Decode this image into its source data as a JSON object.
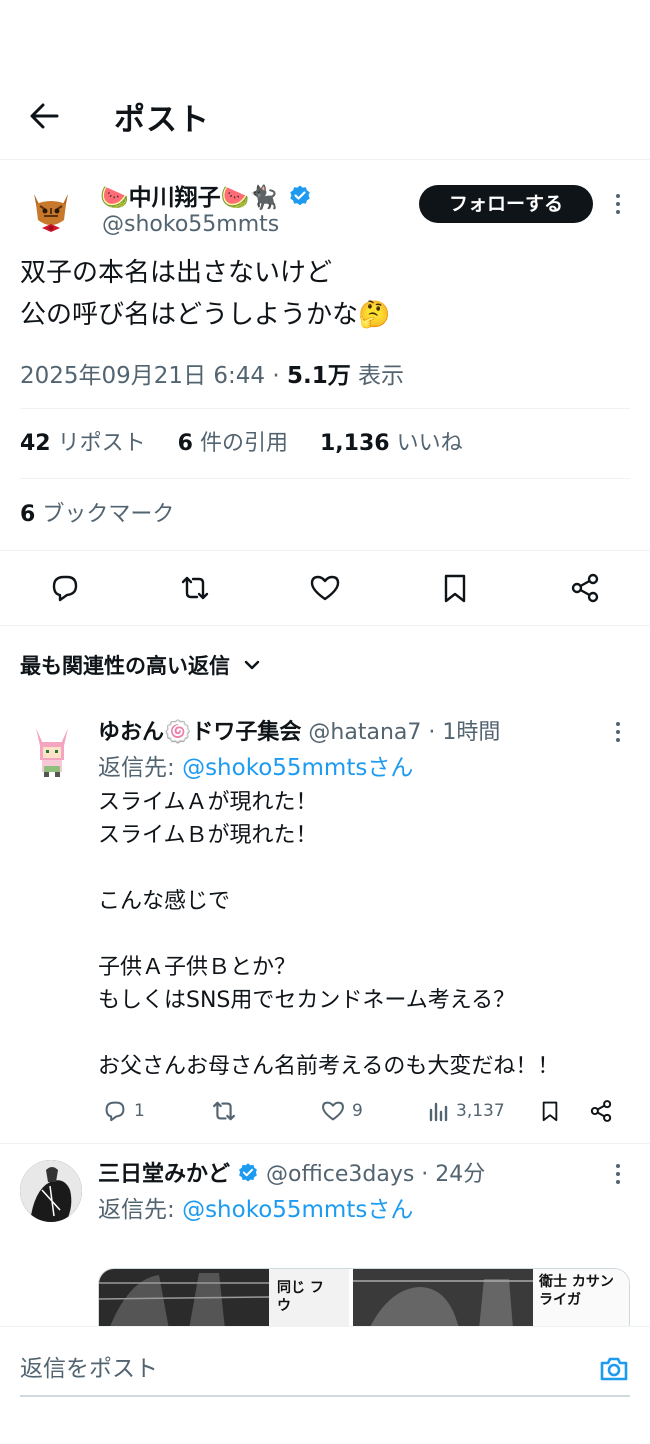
{
  "header": {
    "title": "ポスト"
  },
  "post": {
    "author_name": "🍉中川翔子🍉🐈‍⬛",
    "author_handle": "@shoko55mmts",
    "follow_label": "フォローする",
    "body_line1": "双子の本名は出さないけど",
    "body_line2": "公の呼び名はどうしようかな🤔",
    "timestamp": "2025年09月21日 6:44",
    "views": "5.1万",
    "views_label": "表示",
    "reposts": "42",
    "reposts_label": "リポスト",
    "quotes": "6",
    "quotes_label": "件の引用",
    "likes": "1,136",
    "likes_label": "いいね",
    "bookmarks": "6",
    "bookmarks_label": "ブックマーク"
  },
  "replies_sort": {
    "label": "最も関連性の高い返信"
  },
  "replies": [
    {
      "name": "ゆおん🍥ドワ子集会",
      "handle": "@hatana7",
      "time": "1時間",
      "reply_to_prefix": "返信先:",
      "reply_to_handle": "@shoko55mmtsさん",
      "text": "スライムＡが現れた！\nスライムＢが現れた！\n\nこんな感じで\n\n子供Ａ子供Ｂとか？\nもしくはSNS用でセカンドネーム考える？\n\nお父さんお母さん名前考えるのも大変だね！！",
      "reply_count": "1",
      "like_count": "9",
      "view_count": "3,137"
    },
    {
      "name": "三日堂みかど",
      "handle": "@office3days",
      "time": "24分",
      "reply_to_prefix": "返信先:",
      "reply_to_handle": "@shoko55mmtsさん",
      "media_text_a": "同じ フウ",
      "media_text_b": "衛士 カサン ライガ"
    }
  ],
  "compose": {
    "placeholder": "返信をポスト"
  },
  "colors": {
    "text": "#0f1419",
    "secondary": "#536471",
    "link": "#1d9bf0",
    "verified": "#1d9bf0",
    "divider": "#eff3f4"
  }
}
